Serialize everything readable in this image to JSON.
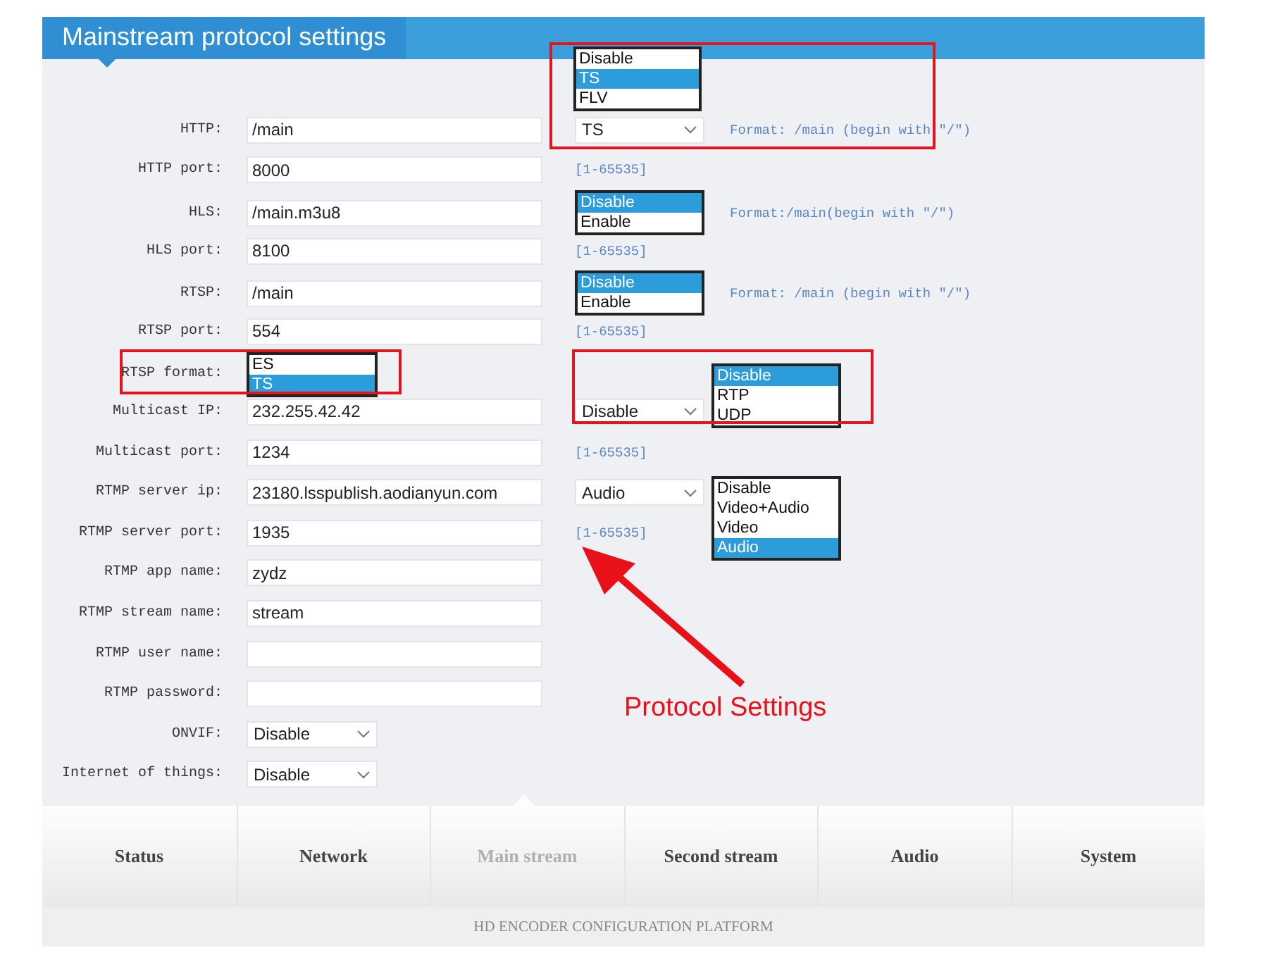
{
  "header": {
    "title": "Mainstream protocol settings"
  },
  "rows": [
    {
      "label": "HTTP:",
      "field": {
        "kind": "input",
        "value": "/main"
      },
      "side": [
        {
          "kind": "popup-above",
          "value": "TS",
          "options": [
            {
              "label": "Disable",
              "selected": false
            },
            {
              "label": "TS",
              "selected": true
            },
            {
              "label": "FLV",
              "selected": false
            }
          ]
        },
        {
          "kind": "hint",
          "text": "Format: /main (begin with \"/\")"
        }
      ]
    },
    {
      "label": "HTTP port:",
      "field": {
        "kind": "input",
        "value": "8000"
      },
      "side": [
        {
          "kind": "range",
          "text": "[1-65535]"
        }
      ]
    },
    {
      "label": "HLS:",
      "field": {
        "kind": "input",
        "value": "/main.m3u8"
      },
      "side": [
        {
          "kind": "list",
          "options": [
            {
              "label": "Disable",
              "selected": true
            },
            {
              "label": "Enable",
              "selected": false
            }
          ]
        },
        {
          "kind": "hint",
          "text": "Format:/main(begin with \"/\")"
        }
      ]
    },
    {
      "label": "HLS port:",
      "field": {
        "kind": "input",
        "value": "8100"
      },
      "side": [
        {
          "kind": "range",
          "text": "[1-65535]"
        }
      ]
    },
    {
      "label": "RTSP:",
      "field": {
        "kind": "input",
        "value": "/main"
      },
      "side": [
        {
          "kind": "list",
          "options": [
            {
              "label": "Disable",
              "selected": true
            },
            {
              "label": "Enable",
              "selected": false
            }
          ]
        },
        {
          "kind": "hint",
          "text": "Format: /main (begin with \"/\")"
        }
      ]
    },
    {
      "label": "RTSP port:",
      "field": {
        "kind": "input",
        "value": "554"
      },
      "side": [
        {
          "kind": "range",
          "text": "[1-65535]"
        }
      ]
    },
    {
      "label": "RTSP format:",
      "field": {
        "kind": "list",
        "options": [
          {
            "label": "ES",
            "selected": false
          },
          {
            "label": "TS",
            "selected": true
          }
        ]
      },
      "side": []
    },
    {
      "label": "Multicast IP:",
      "field": {
        "kind": "input",
        "value": "232.255.42.42"
      },
      "side": [
        {
          "kind": "popup-right-up",
          "value": "Disable",
          "options": [
            {
              "label": "Disable",
              "selected": true
            },
            {
              "label": "RTP",
              "selected": false
            },
            {
              "label": "UDP",
              "selected": false
            }
          ]
        }
      ]
    },
    {
      "label": "Multicast port:",
      "field": {
        "kind": "input",
        "value": "1234"
      },
      "side": [
        {
          "kind": "range",
          "text": "[1-65535]"
        }
      ]
    },
    {
      "label": "RTMP server ip:",
      "field": {
        "kind": "input",
        "value": "23180.lsspublish.aodianyun.com"
      },
      "side": [
        {
          "kind": "popup-right-down",
          "value": "Audio",
          "options": [
            {
              "label": "Disable",
              "selected": false
            },
            {
              "label": "Video+Audio",
              "selected": false
            },
            {
              "label": "Video",
              "selected": false
            },
            {
              "label": "Audio",
              "selected": true
            }
          ]
        }
      ]
    },
    {
      "label": "RTMP server port:",
      "field": {
        "kind": "input",
        "value": "1935"
      },
      "side": [
        {
          "kind": "range",
          "text": "[1-65535]"
        }
      ]
    },
    {
      "label": "RTMP app name:",
      "field": {
        "kind": "input",
        "value": "zydz"
      },
      "side": []
    },
    {
      "label": "RTMP stream name:",
      "field": {
        "kind": "input",
        "value": "stream"
      },
      "side": []
    },
    {
      "label": "RTMP user name:",
      "field": {
        "kind": "input"
      },
      "side": []
    },
    {
      "label": "RTMP password:",
      "field": {
        "kind": "input"
      },
      "side": []
    },
    {
      "label": "ONVIF:",
      "field": {
        "kind": "select",
        "value": "Disable"
      },
      "side": []
    },
    {
      "label": "Internet of things:",
      "field": {
        "kind": "select",
        "value": "Disable"
      },
      "side": []
    }
  ],
  "annotation": {
    "text": "Protocol Settings"
  },
  "nav": [
    {
      "label": "Status",
      "selected": false
    },
    {
      "label": "Network",
      "selected": false
    },
    {
      "label": "Main stream",
      "selected": true
    },
    {
      "label": "Second stream",
      "selected": false
    },
    {
      "label": "Audio",
      "selected": false
    },
    {
      "label": "System",
      "selected": false
    }
  ],
  "footer": "HD ENCODER CONFIGURATION PLATFORM"
}
